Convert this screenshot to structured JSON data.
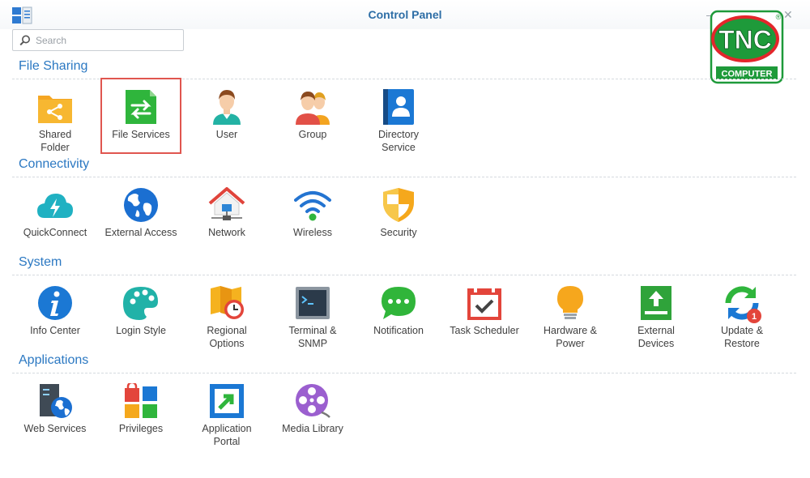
{
  "window": {
    "title": "Control Panel",
    "minimize_glyph": "–",
    "close_glyph": "✕"
  },
  "search": {
    "placeholder": "Search",
    "value": ""
  },
  "brand": {
    "logo_text": "TNC",
    "logo_subtext": "COMPUTER",
    "logo_mark": "®"
  },
  "colors": {
    "accent": "#2b78c2",
    "highlight": "#e0564f",
    "brand_green": "#1e9a3a",
    "brand_red": "#e3262b"
  },
  "sections": [
    {
      "title": "File Sharing",
      "items": [
        {
          "label": "Shared\nFolder",
          "icon": "shared-folder-icon"
        },
        {
          "label": "File Services",
          "icon": "file-services-icon"
        },
        {
          "label": "User",
          "icon": "user-icon"
        },
        {
          "label": "Group",
          "icon": "group-icon"
        },
        {
          "label": "Directory\nService",
          "icon": "directory-service-icon"
        }
      ]
    },
    {
      "title": "Connectivity",
      "items": [
        {
          "label": "QuickConnect",
          "icon": "quickconnect-icon"
        },
        {
          "label": "External Access",
          "icon": "globe-icon"
        },
        {
          "label": "Network",
          "icon": "network-house-icon"
        },
        {
          "label": "Wireless",
          "icon": "wifi-icon"
        },
        {
          "label": "Security",
          "icon": "shield-icon"
        }
      ]
    },
    {
      "title": "System",
      "items": [
        {
          "label": "Info Center",
          "icon": "info-icon"
        },
        {
          "label": "Login Style",
          "icon": "palette-icon"
        },
        {
          "label": "Regional\nOptions",
          "icon": "map-clock-icon"
        },
        {
          "label": "Terminal &\nSNMP",
          "icon": "terminal-icon"
        },
        {
          "label": "Notification",
          "icon": "chat-bubble-icon"
        },
        {
          "label": "Task Scheduler",
          "icon": "calendar-check-icon"
        },
        {
          "label": "Hardware &\nPower",
          "icon": "lightbulb-icon"
        },
        {
          "label": "External\nDevices",
          "icon": "upload-device-icon"
        },
        {
          "label": "Update &\nRestore",
          "icon": "refresh-icon",
          "badge": "1"
        }
      ]
    },
    {
      "title": "Applications",
      "items": [
        {
          "label": "Web Services",
          "icon": "web-services-icon"
        },
        {
          "label": "Privileges",
          "icon": "privileges-icon"
        },
        {
          "label": "Application\nPortal",
          "icon": "app-portal-icon"
        },
        {
          "label": "Media Library",
          "icon": "film-reel-icon"
        }
      ]
    }
  ]
}
